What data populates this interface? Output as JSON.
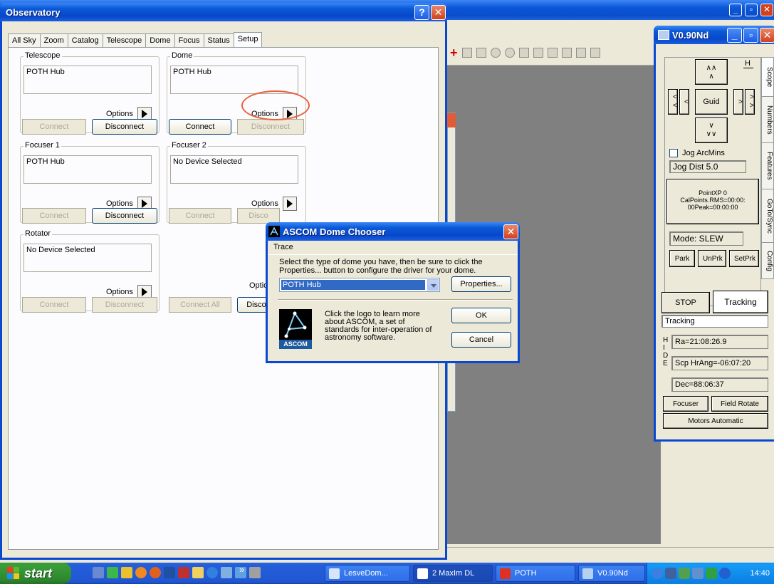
{
  "background_app": {
    "statusbar": "",
    "partial_label": "MaxIm DL"
  },
  "observatory": {
    "title": "Observatory",
    "help_btn": "?",
    "close_btn": "✕",
    "tabs": [
      "All Sky",
      "Zoom",
      "Catalog",
      "Telescope",
      "Dome",
      "Focus",
      "Status",
      "Setup"
    ],
    "active_tab": "Setup",
    "groups": {
      "telescope": {
        "legend": "Telescope",
        "device": "POTH Hub",
        "options": "Options",
        "connect": "Connect",
        "disconnect": "Disconnect"
      },
      "dome": {
        "legend": "Dome",
        "device": "POTH Hub",
        "options": "Options",
        "connect": "Connect",
        "disconnect": "Disconnect"
      },
      "focuser1": {
        "legend": "Focuser 1",
        "device": "POTH Hub",
        "options": "Options",
        "connect": "Connect",
        "disconnect": "Disconnect"
      },
      "focuser2": {
        "legend": "Focuser 2",
        "device": "No Device Selected",
        "options": "Options",
        "connect": "Connect",
        "disconnect": "Disco"
      },
      "rotator": {
        "legend": "Rotator",
        "device": "No Device Selected",
        "options": "Options",
        "connect": "Connect",
        "disconnect": "Disconnect"
      }
    },
    "partial_options": "Optio",
    "connect_all": "Connect All",
    "disconnect_all_partial": "Discon"
  },
  "chooser": {
    "title": "ASCOM Dome Chooser",
    "menu": "Trace",
    "instructions": "Select the type of dome you have, then be sure to click the Properties... button to configure the driver for your dome.",
    "selected": "POTH Hub",
    "properties": "Properties...",
    "about": "Click the logo to learn more about ASCOM, a set of standards for inter-operation of astronomy software.",
    "logo_text": "ASCOM",
    "ok": "OK",
    "cancel": "Cancel"
  },
  "scope_panel": {
    "title": "V0.90Nd",
    "h_label": "H",
    "north2": "∧∧",
    "north1": "∧",
    "west2": "<\n<",
    "west1": "<",
    "guide": "Guid",
    "east1": ">",
    "east2": ">\n>",
    "south1": "∨",
    "south2": "∨∨",
    "jog_arcmins": "Jog ArcMins",
    "jog_dist": "Jog Dist 5.0",
    "point_xp": "PointXP 0",
    "calpoints": "CalPoints.RMS=00:00:",
    "peak": "00Peak=00:00:00",
    "mode": "Mode:  SLEW",
    "park": "Park",
    "unprk": "UnPrk",
    "setprk": "SetPrk",
    "stop": "STOP",
    "tracking_btn": "Tracking",
    "tracking_status": "Tracking",
    "ra": "Ra=21:08:26.9",
    "hrang": "Scp HrAng=-06:07:20",
    "dec": "Dec=88:06:37",
    "hide": "H\nI\nD\nE",
    "focuser": "Focuser",
    "field_rotate": "Field Rotate",
    "motors": "Motors Automatic",
    "vtabs": [
      "Scope",
      "Numbers",
      "Features",
      "GoTo/Sync",
      "Config"
    ]
  },
  "taskbar": {
    "start": "start",
    "chevron": "»",
    "buttons": [
      "LesveDom...",
      "2 MaxIm DL",
      "POTH",
      "V0.90Nd"
    ],
    "clock": "14:40"
  }
}
